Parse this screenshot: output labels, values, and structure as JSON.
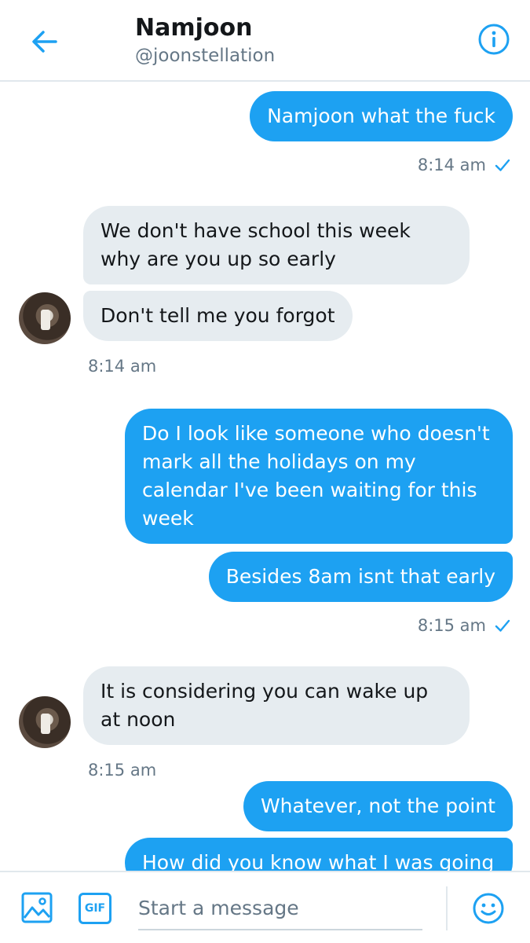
{
  "header": {
    "name": "Namjoon",
    "handle": "@joonstellation"
  },
  "messages": [
    {
      "text": "Namjoon what the fuck"
    },
    {
      "text": "We don't have school this week why are you up so early"
    },
    {
      "text": "Don't tell me you forgot"
    },
    {
      "text": "Do I look like someone who doesn't mark all the holidays on my calendar I've been waiting for this week"
    },
    {
      "text": "Besides 8am isnt that early"
    },
    {
      "text": "It is considering you can wake up at noon"
    },
    {
      "text": "Whatever, not the point"
    },
    {
      "text": "How did you know what I was going"
    }
  ],
  "timestamps": [
    "8:14 am",
    "8:14 am",
    "8:15 am",
    "8:15 am"
  ],
  "composer": {
    "placeholder": "Start a message",
    "gif_label": "GIF"
  },
  "colors": {
    "accent": "#1da1f2",
    "received_bubble": "#e6ecf0"
  }
}
